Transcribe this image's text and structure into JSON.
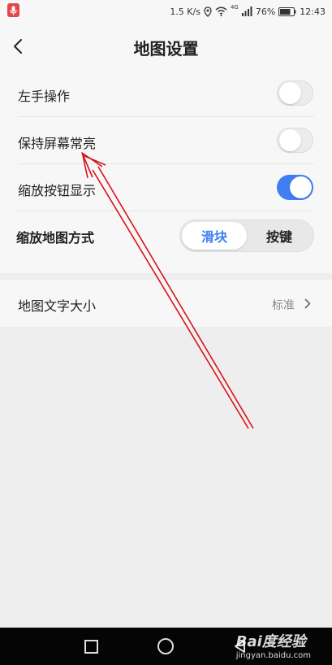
{
  "status": {
    "net_speed": "1.5 K/s",
    "network": "4G",
    "battery": "76%",
    "time": "12:43"
  },
  "header": {
    "title": "地图设置"
  },
  "settings": {
    "rows": [
      {
        "label": "左手操作",
        "control": "toggle",
        "on": false
      },
      {
        "label": "保持屏幕常亮",
        "control": "toggle",
        "on": false
      },
      {
        "label": "缩放按钮显示",
        "control": "toggle",
        "on": true
      }
    ],
    "zoom_mode": {
      "label": "缩放地图方式",
      "options": [
        "滑块",
        "按键"
      ],
      "selected": "滑块"
    },
    "text_size": {
      "label": "地图文字大小",
      "value": "标准"
    }
  },
  "colors": {
    "accent": "#3f7ff3",
    "annotation_arrow": "#d8121a"
  },
  "watermark": {
    "logo": "Bai度经验",
    "url": "jingyan.baidu.com"
  }
}
